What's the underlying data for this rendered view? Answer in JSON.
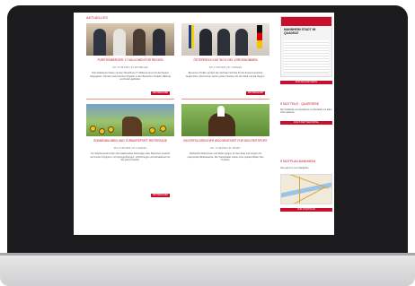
{
  "main": {
    "section_heading": "AKTUELLES",
    "posts": [
      {
        "title": "FÜRSTENBERGER: 17 MILLIONEN FÜR REGION",
        "meta": "DO, 17.08.2023 | IN: AKTUELLES",
        "excerpt": "Drei Fraktionen haben mit dem Beschluss 17 Millionen Euro für die Region freigegeben. Mit dem Geld werden Projekte in den Bereichen Verkehr, Bildung und Kultur gefördert.",
        "button": "WEITERLESEN"
      },
      {
        "title": "ÖSTERREICH HAT SICH VIEL VORGENOMMEN",
        "meta": "DO, 17.08.2023 | IN: LOKALES",
        "excerpt": "Bei einem Treffen wurden die nächsten Schritte für die Zusammenarbeit besprochen. Die Partner sehen große Chancen für die Stadt und die Region.",
        "button": "WEITERLESEN"
      },
      {
        "title": "SONNENBLUMEN UND TURNIERSPORT: REITERTAGE",
        "meta": "DO, 17.08.2023 | IN: LOKALES",
        "excerpt": "Am Wochenende finden die traditionellen Reitertage statt. Besucher erwartet ein buntes Programm mit Springprüfungen, Vorführungen und Attraktionen für die ganze Familie.",
        "button": "WEITERLESEN"
      },
      {
        "title": "EIN ERFOLGREICHER WOCHENSTART FÜR DEN REITSPORT",
        "meta": "DO, 17.08.2023 | IN: SPORT",
        "excerpt": "Zahlreiche Reiterinnen und Reiter gingen an den Start und sorgten für spannende Wettbewerbe. Die Veranstalter ziehen eine positive Bilanz des Turniers.",
        "button": "WEITERLESEN"
      }
    ]
  },
  "sidebar": {
    "poster_title": "MANNHEIM STADT IM QUADRAT",
    "poster_button": "ZUR MAGAZIN-SEITE",
    "section2_title": "STADTTEILE · QUARTIERE",
    "section2_text": "Die Stadtteile und Quartiere im Überblick mit allen Informationen.",
    "section2_button": "ZUM STADTTEILPORTAL",
    "section3_title": "STADTPLAN MANNHEIM",
    "section3_text": "Hier geht es zum Stadtplan.",
    "section3_button": "ZUM STADTPLAN"
  },
  "colors": {
    "accent": "#c8102e",
    "bezel": "#1b1b1d"
  }
}
